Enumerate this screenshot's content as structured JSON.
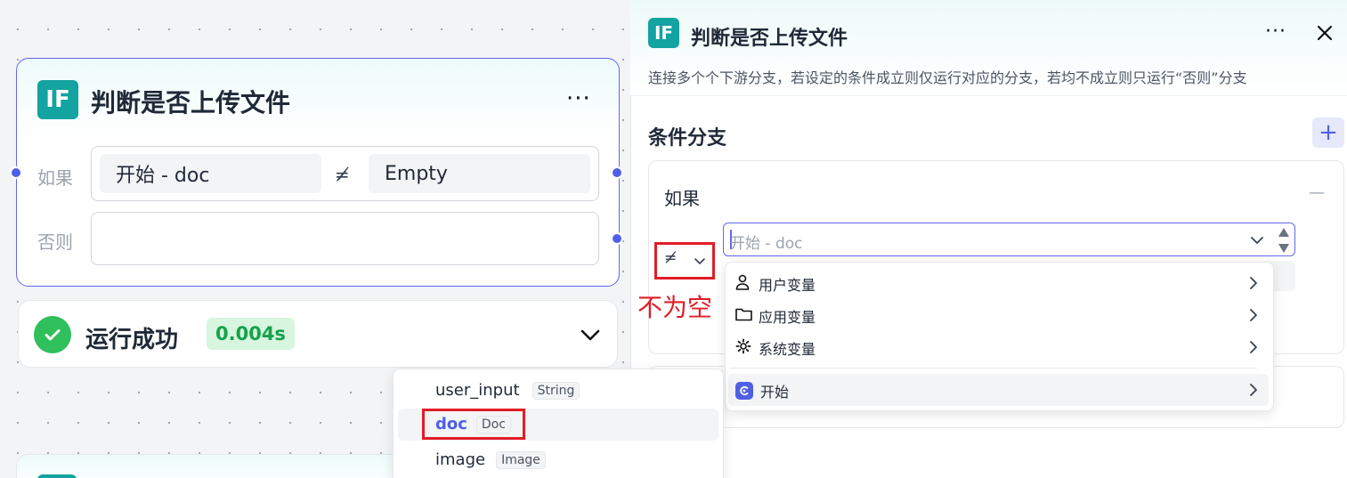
{
  "node": {
    "badge": "IF",
    "title": "判断是否上传文件",
    "more": "···",
    "if_label": "如果",
    "else_label": "否则",
    "condition": {
      "variable": "开始  -  doc",
      "operator_symbol": "≠̸",
      "value": "Empty"
    }
  },
  "run_status": {
    "label": "运行成功",
    "time": "0.004s"
  },
  "panel": {
    "badge": "IF",
    "title": "判断是否上传文件",
    "more": "···",
    "close": "✕",
    "description": "连接多个个下游分支，若设定的条件成立则仅运行对应的分支，若均不成立则只运行“否则”分支",
    "section_title": "条件分支",
    "add": "+",
    "if_label": "如果",
    "collapse": "—",
    "variable_placeholder": "开始 - doc",
    "operator_symbol": "≠̸",
    "annotation": "不为空"
  },
  "var_menu": {
    "items": [
      {
        "icon": "user-icon",
        "label": "用户变量"
      },
      {
        "icon": "folder-icon",
        "label": "应用变量"
      },
      {
        "icon": "gear-icon",
        "label": "系统变量"
      },
      {
        "icon": "start-icon",
        "label": "开始"
      }
    ]
  },
  "start_vars": {
    "items": [
      {
        "name": "user_input",
        "type": "String"
      },
      {
        "name": "doc",
        "type": "Doc"
      },
      {
        "name": "image",
        "type": "Image"
      }
    ]
  }
}
